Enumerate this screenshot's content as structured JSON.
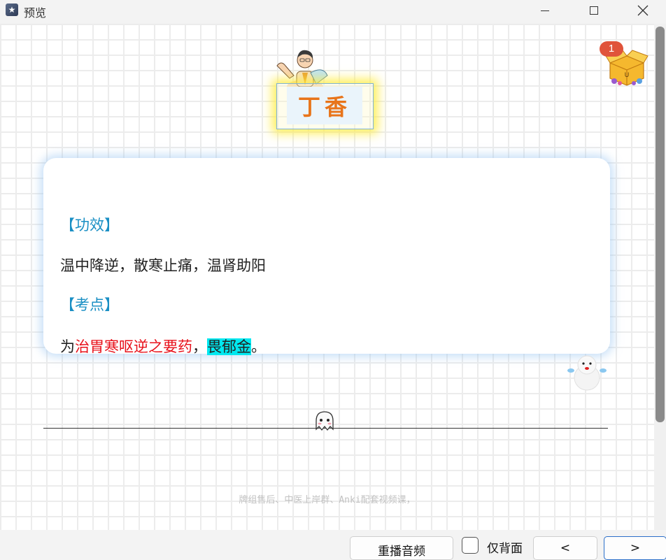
{
  "window": {
    "title": "预览"
  },
  "card": {
    "herb_name": "丁香",
    "section1_heading": "【功效】",
    "section1_text": "温中降逆，散寒止痛，温肾助阳",
    "section2_heading": "【考点】",
    "kaodian": {
      "prefix": "为",
      "red_text": "治胃寒呕逆之要药",
      "comma": "，",
      "highlight_text": "畏郁金",
      "suffix": "。"
    }
  },
  "badge": {
    "count": "1"
  },
  "footer": {
    "text": "牌组售后、中医上岸群、Anki配套视频课，"
  },
  "toolbar": {
    "replay_label": "重播音频",
    "back_only_label": "仅背面",
    "back_only_checked": false,
    "prev_label": "<",
    "next_label": ">"
  },
  "colors": {
    "title_orange": "#e8741a",
    "heading_blue": "#1a8fc4",
    "emphasis_red": "#e8101a",
    "highlight_cyan": "#00e8f0",
    "badge_red": "#e0533a"
  }
}
